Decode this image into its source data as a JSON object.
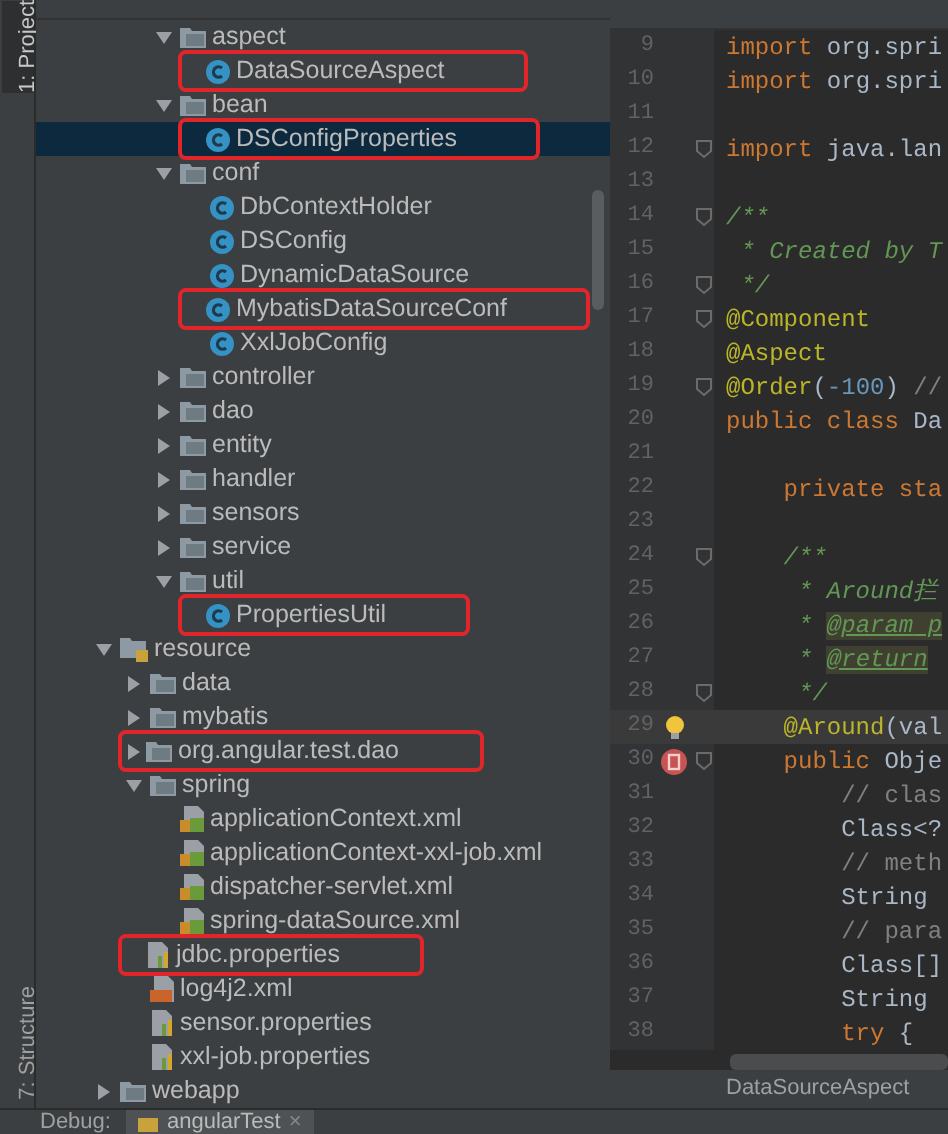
{
  "tool_tabs_top": [
    {
      "label": "1: Project",
      "selected": true
    }
  ],
  "tool_tabs_bottom": [
    {
      "label": "7: Structure",
      "selected": false
    }
  ],
  "tree": [
    {
      "children": [
        {
          "children": [
            {
              "label": "aspect",
              "kind": "folder",
              "expanded": true,
              "selected": false,
              "boxed": false,
              "children": [
                {
                  "label": "DataSourceAspect",
                  "kind": "class",
                  "selected": false,
                  "boxed": true
                }
              ]
            },
            {
              "label": "bean",
              "kind": "folder",
              "expanded": true,
              "selected": false,
              "boxed": false,
              "children": [
                {
                  "label": "DSConfigProperties",
                  "kind": "class",
                  "selected": true,
                  "boxed": true
                }
              ]
            },
            {
              "label": "conf",
              "kind": "folder",
              "expanded": true,
              "selected": false,
              "boxed": false,
              "children": [
                {
                  "label": "DbContextHolder",
                  "kind": "class",
                  "selected": false,
                  "boxed": false
                },
                {
                  "label": "DSConfig",
                  "kind": "class",
                  "selected": false,
                  "boxed": false
                },
                {
                  "label": "DynamicDataSource",
                  "kind": "class",
                  "selected": false,
                  "boxed": false
                },
                {
                  "label": "MybatisDataSourceConf",
                  "kind": "class",
                  "selected": false,
                  "boxed": true
                },
                {
                  "label": "XxlJobConfig",
                  "kind": "class",
                  "selected": false,
                  "boxed": false
                }
              ]
            },
            {
              "label": "controller",
              "kind": "folder",
              "expanded": false,
              "selected": false,
              "boxed": false
            },
            {
              "label": "dao",
              "kind": "folder",
              "expanded": false,
              "selected": false,
              "boxed": false
            },
            {
              "label": "entity",
              "kind": "folder",
              "expanded": false,
              "selected": false,
              "boxed": false
            },
            {
              "label": "handler",
              "kind": "folder",
              "expanded": false,
              "selected": false,
              "boxed": false
            },
            {
              "label": "sensors",
              "kind": "folder",
              "expanded": false,
              "selected": false,
              "boxed": false
            },
            {
              "label": "service",
              "kind": "folder",
              "expanded": false,
              "selected": false,
              "boxed": false
            },
            {
              "label": "util",
              "kind": "folder",
              "expanded": true,
              "selected": false,
              "boxed": false,
              "children": [
                {
                  "label": "PropertiesUtil",
                  "kind": "class",
                  "selected": false,
                  "boxed": true
                }
              ]
            }
          ]
        }
      ]
    },
    {
      "label": "resource",
      "kind": "resource-folder",
      "expanded": true,
      "selected": false,
      "boxed": false,
      "children": [
        {
          "label": "data",
          "kind": "folder",
          "expanded": false,
          "selected": false,
          "boxed": false
        },
        {
          "label": "mybatis",
          "kind": "folder",
          "expanded": false,
          "selected": false,
          "boxed": false
        },
        {
          "label": "org.angular.test.dao",
          "kind": "folder",
          "expanded": false,
          "selected": false,
          "boxed": true
        },
        {
          "label": "spring",
          "kind": "folder",
          "expanded": true,
          "selected": false,
          "boxed": false,
          "children": [
            {
              "label": "applicationContext.xml",
              "kind": "spring-xml",
              "selected": false,
              "boxed": false
            },
            {
              "label": "applicationContext-xxl-job.xml",
              "kind": "spring-xml",
              "selected": false,
              "boxed": false
            },
            {
              "label": "dispatcher-servlet.xml",
              "kind": "spring-xml",
              "selected": false,
              "boxed": false
            },
            {
              "label": "spring-dataSource.xml",
              "kind": "spring-xml",
              "selected": false,
              "boxed": false
            }
          ]
        },
        {
          "label": "jdbc.properties",
          "kind": "properties",
          "selected": false,
          "boxed": true
        },
        {
          "label": "log4j2.xml",
          "kind": "xml",
          "selected": false,
          "boxed": false
        },
        {
          "label": "sensor.properties",
          "kind": "properties",
          "selected": false,
          "boxed": false
        },
        {
          "label": "xxl-job.properties",
          "kind": "properties",
          "selected": false,
          "boxed": false
        }
      ]
    },
    {
      "label": "webapp",
      "kind": "folder",
      "expanded": false,
      "selected": false,
      "boxed": false
    }
  ],
  "code_lines": [
    {
      "number": "9",
      "fold": false,
      "current": false,
      "tokens": [
        {
          "text": "import ",
          "kind": "keyword"
        },
        {
          "text": "org.spri",
          "kind": "plain"
        }
      ]
    },
    {
      "number": "10",
      "fold": false,
      "current": false,
      "tokens": [
        {
          "text": "import ",
          "kind": "keyword"
        },
        {
          "text": "org.spri",
          "kind": "plain"
        }
      ]
    },
    {
      "number": "11",
      "fold": false,
      "current": false
    },
    {
      "number": "12",
      "fold": true,
      "current": false,
      "tokens": [
        {
          "text": "import ",
          "kind": "keyword"
        },
        {
          "text": "java.lan",
          "kind": "plain"
        }
      ]
    },
    {
      "number": "13",
      "fold": false,
      "current": false
    },
    {
      "number": "14",
      "fold": true,
      "current": false,
      "tokens": [
        {
          "text": "/**",
          "kind": "doc"
        }
      ]
    },
    {
      "number": "15",
      "fold": false,
      "current": false,
      "tokens": [
        {
          "text": " * Created by T",
          "kind": "doc"
        }
      ]
    },
    {
      "number": "16",
      "fold": true,
      "current": false,
      "tokens": [
        {
          "text": " */",
          "kind": "doc"
        }
      ]
    },
    {
      "number": "17",
      "fold": true,
      "current": false,
      "tokens": [
        {
          "text": "@Component",
          "kind": "annotation"
        }
      ]
    },
    {
      "number": "18",
      "fold": false,
      "current": false,
      "tokens": [
        {
          "text": "@Aspect",
          "kind": "annotation"
        }
      ]
    },
    {
      "number": "19",
      "fold": true,
      "current": false,
      "tokens": [
        {
          "text": "@Order",
          "kind": "annotation"
        },
        {
          "text": "(",
          "kind": "plain"
        },
        {
          "text": "-100",
          "kind": "number"
        },
        {
          "text": ") ",
          "kind": "plain"
        },
        {
          "text": "//",
          "kind": "comment"
        }
      ]
    },
    {
      "number": "20",
      "fold": false,
      "current": false,
      "tokens": [
        {
          "text": "public class ",
          "kind": "keyword"
        },
        {
          "text": "Da",
          "kind": "plain"
        }
      ]
    },
    {
      "number": "21",
      "fold": false,
      "current": false
    },
    {
      "number": "22",
      "fold": false,
      "current": false,
      "tokens": [
        {
          "text": "    private sta",
          "kind": "keyword"
        }
      ]
    },
    {
      "number": "23",
      "fold": false,
      "current": false
    },
    {
      "number": "24",
      "fold": true,
      "current": false,
      "tokens": [
        {
          "text": "    /**",
          "kind": "doc"
        }
      ]
    },
    {
      "number": "25",
      "fold": false,
      "current": false,
      "tokens": [
        {
          "text": "     * Around拦",
          "kind": "doc"
        }
      ]
    },
    {
      "number": "26",
      "fold": false,
      "current": false,
      "tokens": [
        {
          "text": "     * ",
          "kind": "doc"
        },
        {
          "text": "@param",
          "kind": "doc-tag"
        },
        {
          "text": " p",
          "kind": "doc-tag"
        }
      ]
    },
    {
      "number": "27",
      "fold": false,
      "current": false,
      "tokens": [
        {
          "text": "     * ",
          "kind": "doc"
        },
        {
          "text": "@return",
          "kind": "doc-tag"
        }
      ]
    },
    {
      "number": "28",
      "fold": true,
      "current": false,
      "tokens": [
        {
          "text": "     */",
          "kind": "doc"
        }
      ]
    },
    {
      "number": "29",
      "fold": false,
      "current": true,
      "gutter": {
        "kind": "bulb"
      },
      "tokens": [
        {
          "text": "    @Around",
          "kind": "annotation"
        },
        {
          "text": "(val",
          "kind": "plain"
        }
      ]
    },
    {
      "number": "30",
      "fold": true,
      "current": false,
      "gutter": {
        "kind": "breakpoint"
      },
      "tokens": [
        {
          "text": "    public ",
          "kind": "keyword"
        },
        {
          "text": "Obje",
          "kind": "plain"
        }
      ]
    },
    {
      "number": "31",
      "fold": false,
      "current": false,
      "tokens": [
        {
          "text": "        // clas",
          "kind": "comment"
        }
      ]
    },
    {
      "number": "32",
      "fold": false,
      "current": false,
      "tokens": [
        {
          "text": "        Class<?",
          "kind": "plain"
        }
      ]
    },
    {
      "number": "33",
      "fold": false,
      "current": false,
      "tokens": [
        {
          "text": "        // meth",
          "kind": "comment"
        }
      ]
    },
    {
      "number": "34",
      "fold": false,
      "current": false,
      "tokens": [
        {
          "text": "        String",
          "kind": "plain"
        }
      ]
    },
    {
      "number": "35",
      "fold": false,
      "current": false,
      "tokens": [
        {
          "text": "        // para",
          "kind": "comment"
        }
      ]
    },
    {
      "number": "36",
      "fold": false,
      "current": false,
      "tokens": [
        {
          "text": "        Class[]",
          "kind": "plain"
        }
      ]
    },
    {
      "number": "37",
      "fold": false,
      "current": false,
      "tokens": [
        {
          "text": "        String",
          "kind": "plain"
        }
      ]
    },
    {
      "number": "38",
      "fold": false,
      "current": false,
      "tokens": [
        {
          "text": "        try ",
          "kind": "keyword"
        },
        {
          "text": "{",
          "kind": "plain"
        }
      ]
    }
  ],
  "breadcrumb": [
    "DataSourceAspect"
  ],
  "debug_bar": {
    "label": "Debug:",
    "tabs": [
      {
        "label": "angularTest",
        "selected": true,
        "close": "×"
      }
    ]
  }
}
